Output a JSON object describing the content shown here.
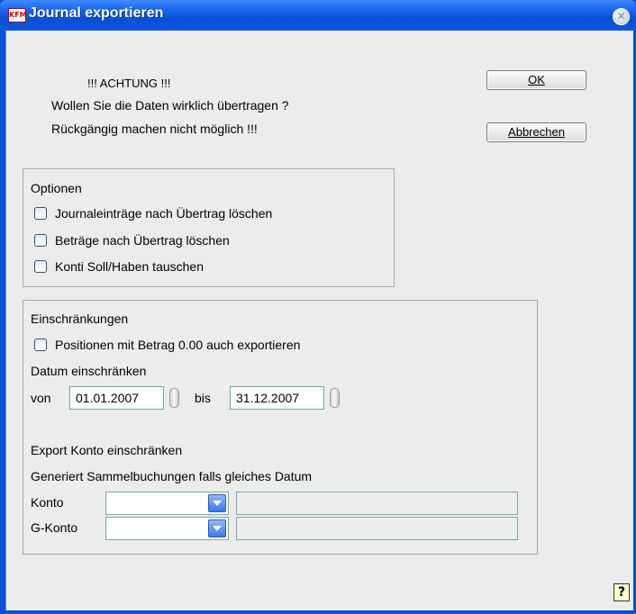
{
  "window": {
    "title": "Journal exportieren",
    "icon_text": "KFM",
    "close_glyph": "✕"
  },
  "warning": {
    "line1": "!!! ACHTUNG !!!",
    "line2": "Wollen Sie die Daten wirklich übertragen ?",
    "line3": "Rückgängig machen nicht möglich !!!"
  },
  "buttons": {
    "ok": "OK",
    "cancel": "Abbrechen",
    "help": "?"
  },
  "options": {
    "title": "Optionen",
    "items": [
      {
        "label": "Journaleinträge nach Übertrag löschen",
        "checked": false
      },
      {
        "label": "Beträge nach Übertrag löschen",
        "checked": false
      },
      {
        "label": "Konti Soll/Haben tauschen",
        "checked": false
      }
    ]
  },
  "restrictions": {
    "title": "Einschränkungen",
    "zero_positions": {
      "label": "Positionen mit Betrag 0.00 auch exportieren",
      "checked": false
    },
    "date_title": "Datum einschränken",
    "from_label": "von",
    "from_value": "01.01.2007",
    "to_label": "bis",
    "to_value": "31.12.2007",
    "account_title": "Export Konto einschränken",
    "account_note": "Generiert Sammelbuchungen falls gleiches Datum",
    "konto_label": "Konto",
    "konto_value": "",
    "konto_desc": "",
    "gkonto_label": "G-Konto",
    "gkonto_value": "",
    "gkonto_desc": ""
  },
  "icons": {
    "app": "kfm-app-icon",
    "close": "close-icon",
    "spin": "spinner-icon",
    "dropdown": "chevron-down-icon",
    "help": "help-icon"
  },
  "colors": {
    "title_bar": "#0a4fd6",
    "client_bg": "#ececec",
    "input_border": "#6aa7a7",
    "dropdown_accent": "#3f79e8"
  }
}
